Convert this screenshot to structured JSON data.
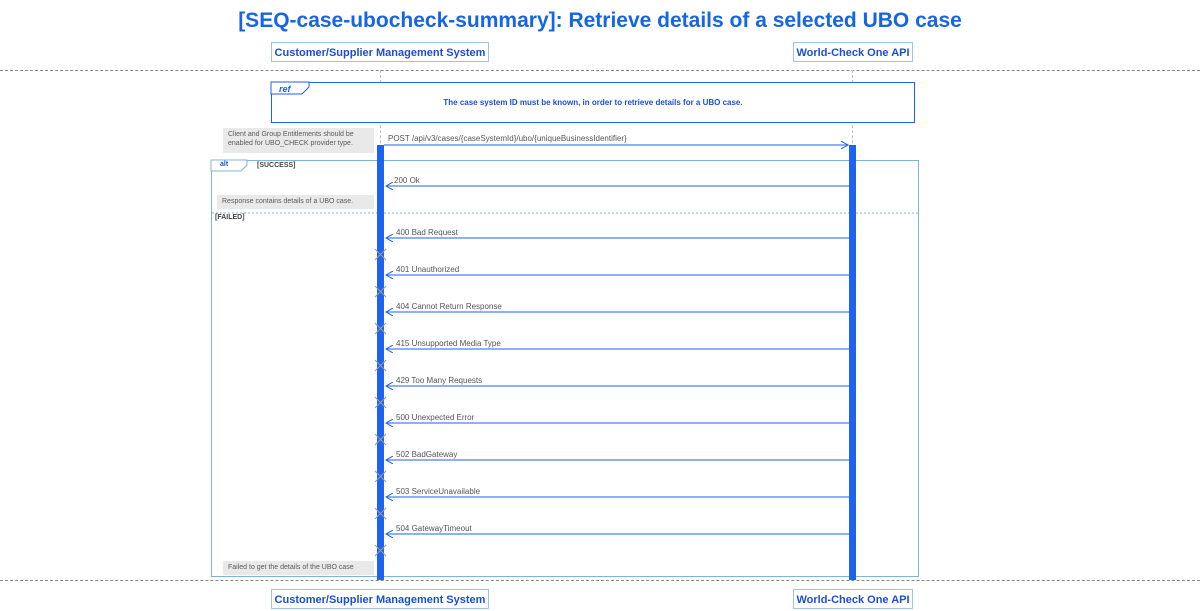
{
  "title": "[SEQ-case-ubocheck-summary]: Retrieve details of a selected UBO case",
  "participants": {
    "left": "Customer/Supplier Management System",
    "right": "World-Check One API"
  },
  "ref": {
    "label": "ref",
    "text": "The case system ID must be known, in order to retrieve details for a UBO case."
  },
  "notes": {
    "entitlements": "Client and Group Entitlements should be enabled for UBO_CHECK provider type.",
    "success": "Response contains details of a UBO case.",
    "failed": "Failed to get the details of the UBO case"
  },
  "request": "POST /api/v3/cases/{caseSystemId}/ubo/{uniqueBusinessIdentifier}",
  "alt": {
    "label": "alt",
    "success_guard": "[SUCCESS]",
    "failed_guard": "[FAILED]"
  },
  "responses": {
    "success": "200 Ok",
    "failures": [
      "400 Bad Request",
      "401 Unauthorized",
      "404 Cannot Return Response",
      "415 Unsupported Media Type",
      "429 Too Many Requests",
      "500 Unexpected Error",
      "502 BadGateway",
      "503 ServiceUnavailable",
      "504 GatewayTimeout"
    ]
  },
  "colors": {
    "accent": "#1e62f0",
    "title": "#1565e6",
    "alt_border": "#7fb3dc",
    "note_bg": "#e9e9e9"
  }
}
